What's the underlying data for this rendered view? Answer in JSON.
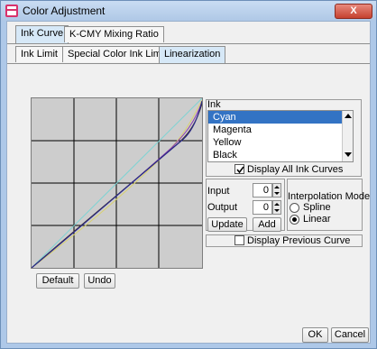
{
  "window": {
    "title": "Color Adjustment",
    "close_label": "X"
  },
  "top_tabs": [
    {
      "label": "Ink Curve",
      "active": true
    },
    {
      "label": "K-CMY Mixing Ratio",
      "active": false
    }
  ],
  "sub_tabs": [
    {
      "label": "Ink Limit",
      "active": false
    },
    {
      "label": "Special Color Ink Limit",
      "active": false
    },
    {
      "label": "Linearization",
      "active": true
    }
  ],
  "ink": {
    "title": "Ink",
    "items": [
      "Cyan",
      "Magenta",
      "Yellow",
      "Black"
    ],
    "selected": "Cyan",
    "display_all_label": "Display All Ink Curves",
    "display_all_checked": true
  },
  "points": {
    "input_label": "Input",
    "input_value": "0",
    "output_label": "Output",
    "output_value": "0",
    "update_label": "Update",
    "add_label": "Add"
  },
  "interpolation": {
    "title": "Interpolation Mode",
    "options": [
      "Spline",
      "Linear"
    ],
    "selected": "Linear"
  },
  "display_previous": {
    "label": "Display Previous Curve",
    "checked": false
  },
  "curve_buttons": {
    "default_label": "Default",
    "undo_label": "Undo"
  },
  "dialog_buttons": {
    "ok_label": "OK",
    "cancel_label": "Cancel"
  },
  "curve_colors": {
    "cyan": "#2a2a8a",
    "magenta": "#8a3ab0",
    "yellow": "#d8d070",
    "black": "#3a2a1a",
    "reference": "#7fd3d3"
  }
}
